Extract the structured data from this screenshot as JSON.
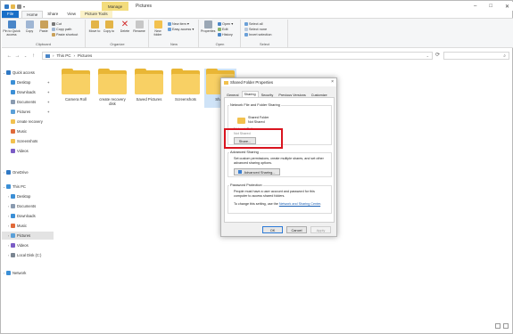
{
  "window": {
    "context_tab": "Manage",
    "title": "Pictures"
  },
  "ribbon_tabs": {
    "file": "File",
    "home": "Home",
    "share": "Share",
    "view": "View",
    "picture_tools": "Picture Tools"
  },
  "ribbon": {
    "clipboard": {
      "pin": "Pin to Quick access",
      "copy": "Copy",
      "paste": "Paste",
      "cut": "Cut",
      "copy_path": "Copy path",
      "paste_shortcut": "Paste shortcut",
      "group": "Clipboard"
    },
    "organize": {
      "move_to": "Move to",
      "copy_to": "Copy to",
      "delete": "Delete",
      "rename": "Rename",
      "group": "Organize"
    },
    "new": {
      "new_folder": "New folder",
      "new_item": "New item",
      "easy_access": "Easy access",
      "group": "New"
    },
    "open": {
      "properties": "Properties",
      "open": "Open",
      "edit": "Edit",
      "history": "History",
      "group": "Open"
    },
    "select": {
      "select_all": "Select all",
      "select_none": "Select none",
      "invert": "Invert selection",
      "group": "Select"
    }
  },
  "address": {
    "segments": [
      "This PC",
      "Pictures"
    ],
    "separator": "›"
  },
  "nav": {
    "quick_access": "Quick access",
    "qa_items": [
      "Desktop",
      "Downloads",
      "Documents",
      "Pictures",
      "create recovery",
      "Music",
      "Screenshots",
      "Videos"
    ],
    "onedrive": "OneDrive",
    "this_pc": "This PC",
    "pc_items": [
      "Desktop",
      "Documents",
      "Downloads",
      "Music",
      "Pictures",
      "Videos",
      "Local Disk (C:)"
    ],
    "network": "Network"
  },
  "folders": [
    {
      "name": "Camera Roll"
    },
    {
      "name": "create recovery disk"
    },
    {
      "name": "Saved Pictures"
    },
    {
      "name": "Screenshots"
    },
    {
      "name": "Share"
    }
  ],
  "dialog": {
    "title": "Shared Folder Properties",
    "close": "×",
    "tabs": [
      "General",
      "Sharing",
      "Security",
      "Previous Versions",
      "Customize"
    ],
    "active_tab": "Sharing",
    "nfs_section": "Network File and Folder Sharing",
    "folder_name": "Shared Folder",
    "folder_status": "Not Shared",
    "network_path_label": "Network Path:",
    "network_path_value": "Not Shared",
    "share_button": "Share...",
    "advanced_section": "Advanced Sharing",
    "advanced_desc": "Set custom permissions, create multiple shares, and set other advanced sharing options.",
    "advanced_button": "Advanced Sharing...",
    "password_section": "Password Protection",
    "password_desc": "People must have a user account and password for this computer to access shared folders.",
    "password_link_prefix": "To change this setting, use the",
    "password_link": "Network and Sharing Center",
    "ok": "OK",
    "cancel": "Cancel",
    "apply": "Apply"
  },
  "colors": {
    "accent": "#1a6fc7",
    "folder": "#f8d064",
    "highlight": "#d9141f"
  }
}
